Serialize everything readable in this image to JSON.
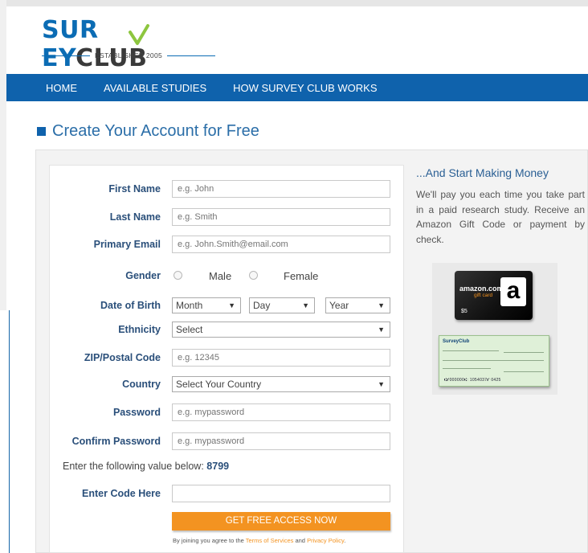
{
  "logo": {
    "name_part1": "SUR",
    "name_part2": "EY",
    "name_part3": "CLUB",
    "tagline": "ESTABLISHED 2005"
  },
  "nav": {
    "items": [
      "HOME",
      "AVAILABLE STUDIES",
      "HOW SURVEY CLUB WORKS"
    ]
  },
  "page": {
    "title": "Create Your Account for Free"
  },
  "form": {
    "first_name": {
      "label": "First Name",
      "placeholder": "e.g. John"
    },
    "last_name": {
      "label": "Last Name",
      "placeholder": "e.g. Smith"
    },
    "email": {
      "label": "Primary Email",
      "placeholder": "e.g. John.Smith@email.com"
    },
    "gender": {
      "label": "Gender",
      "options": [
        "Male",
        "Female"
      ]
    },
    "dob": {
      "label": "Date of Birth",
      "month": "Month",
      "day": "Day",
      "year": "Year"
    },
    "ethnicity": {
      "label": "Ethnicity",
      "value": "Select"
    },
    "zip": {
      "label": "ZIP/Postal Code",
      "placeholder": "e.g. 12345"
    },
    "country": {
      "label": "Country",
      "value": "Select Your Country"
    },
    "password": {
      "label": "Password",
      "placeholder": "e.g. mypassword"
    },
    "confirm_password": {
      "label": "Confirm Password",
      "placeholder": "e.g. mypassword"
    },
    "code_prompt": "Enter the following value below:",
    "code_value": "8799",
    "code_input": {
      "label": "Enter Code Here",
      "placeholder": ""
    },
    "submit_label": "GET FREE ACCESS NOW",
    "terms_prefix": "By joining you agree to the",
    "terms_link": "Terms of Services",
    "terms_and": "and",
    "privacy_link": "Privacy Policy",
    "terms_end": "."
  },
  "sidebar": {
    "title": "...And Start Making Money",
    "text": "We'll pay you each time you take part in a paid research study. Receive an Amazon Gift Code or payment by check."
  },
  "rewards": {
    "amazon_brand": "amazon.com",
    "amazon_sub": "gift card",
    "amazon_value": "$5",
    "check_brand": "SurveyClub",
    "check_micr": "⑆⑈000000⑆: 1054037⑈ 0425"
  },
  "colors": {
    "nav_bg": "#0f62ac",
    "cta": "#f39321",
    "label": "#2a4f7a"
  }
}
